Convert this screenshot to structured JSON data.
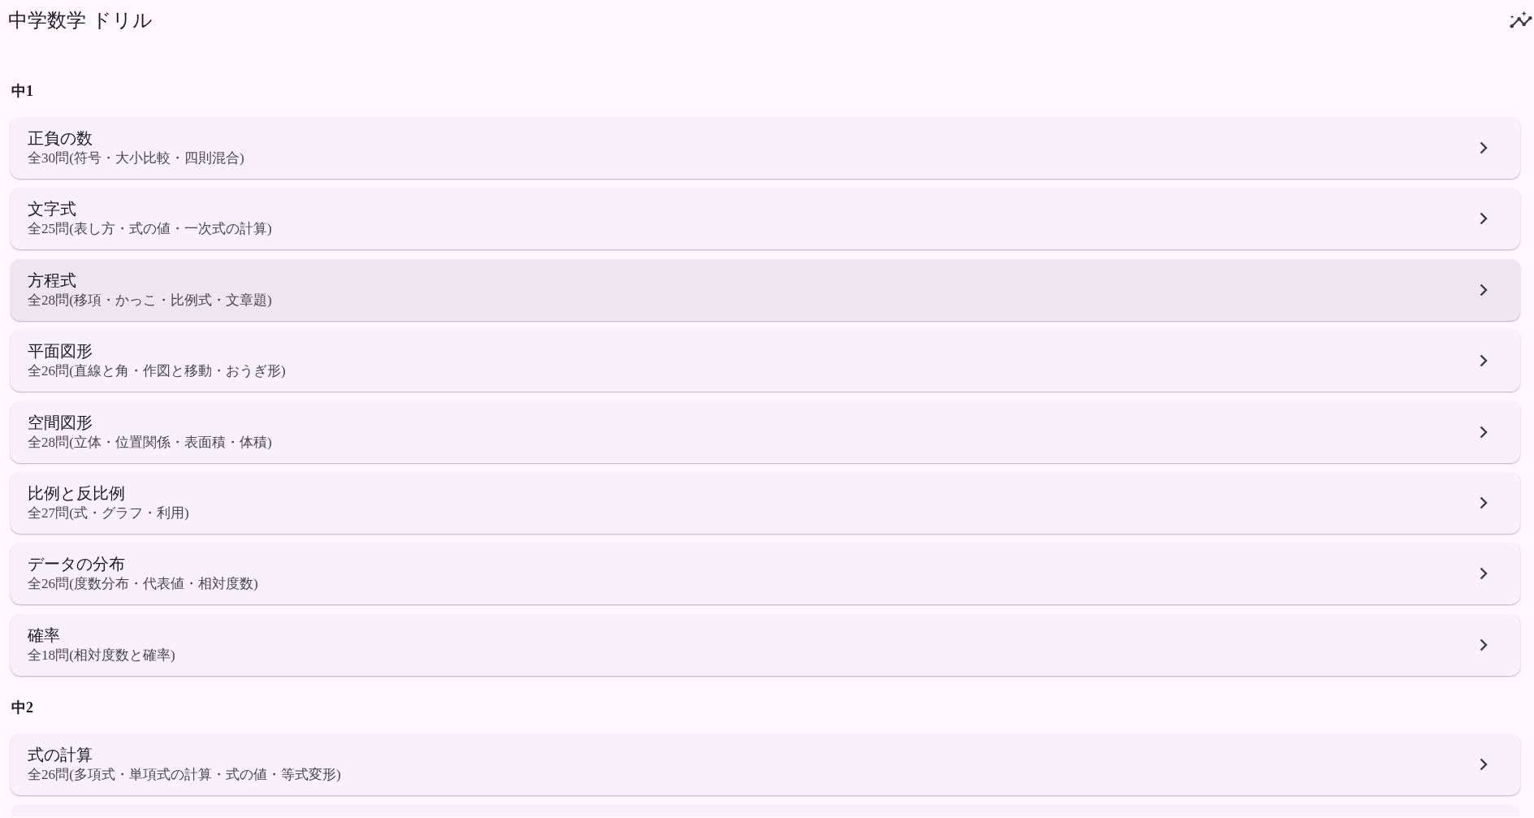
{
  "app_bar": {
    "title": "中学数学 ドリル"
  },
  "sections": [
    {
      "heading": "中1",
      "items": [
        {
          "title": "正負の数",
          "subtitle": "全30問(符号・大小比較・四則混合)",
          "selected": false
        },
        {
          "title": "文字式",
          "subtitle": "全25問(表し方・式の値・一次式の計算)",
          "selected": false
        },
        {
          "title": "方程式",
          "subtitle": "全28問(移項・かっこ・比例式・文章題)",
          "selected": true
        },
        {
          "title": "平面図形",
          "subtitle": "全26問(直線と角・作図と移動・おうぎ形)",
          "selected": false
        },
        {
          "title": "空間図形",
          "subtitle": "全28問(立体・位置関係・表面積・体積)",
          "selected": false
        },
        {
          "title": "比例と反比例",
          "subtitle": "全27問(式・グラフ・利用)",
          "selected": false
        },
        {
          "title": "データの分布",
          "subtitle": "全26問(度数分布・代表値・相対度数)",
          "selected": false
        },
        {
          "title": "確率",
          "subtitle": "全18問(相対度数と確率)",
          "selected": false
        }
      ]
    },
    {
      "heading": "中2",
      "items": [
        {
          "title": "式の計算",
          "subtitle": "全26問(多項式・単項式の計算・式の値・等式変形)",
          "selected": false
        }
      ]
    }
  ]
}
